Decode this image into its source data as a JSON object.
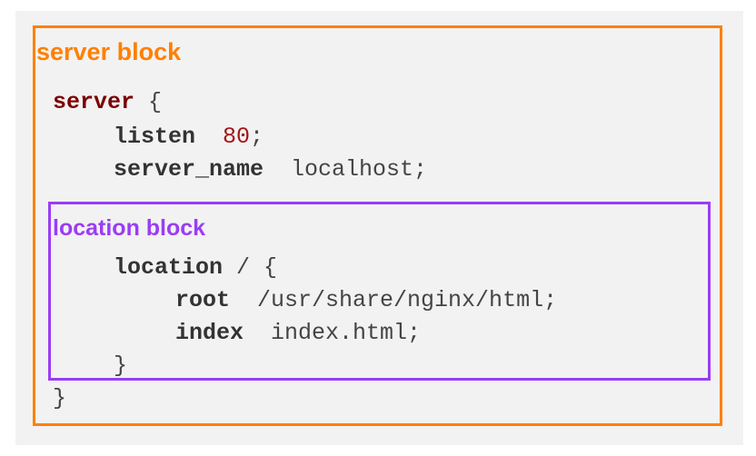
{
  "labels": {
    "server_block": "server block",
    "location_block": "location block"
  },
  "code": {
    "line1": {
      "keyword": "server",
      "rest": " {"
    },
    "line2": {
      "keyword": "listen",
      "gap": "  ",
      "value": "80",
      "end": ";"
    },
    "line3": {
      "keyword": "server_name",
      "rest": "  localhost;"
    },
    "line4": {
      "keyword": "location",
      "rest": " / {"
    },
    "line5": {
      "keyword": "root",
      "rest": "  /usr/share/nginx/html;"
    },
    "line6": {
      "keyword": "index",
      "rest": "  index.html;"
    },
    "line7": {
      "text": "}"
    },
    "line8": {
      "text": "}"
    }
  },
  "colors": {
    "server_block": "#ff8000",
    "location_block": "#9b3cf5",
    "server_keyword": "#7a0000",
    "number": "#a31515",
    "background": "#f2f2f2"
  }
}
